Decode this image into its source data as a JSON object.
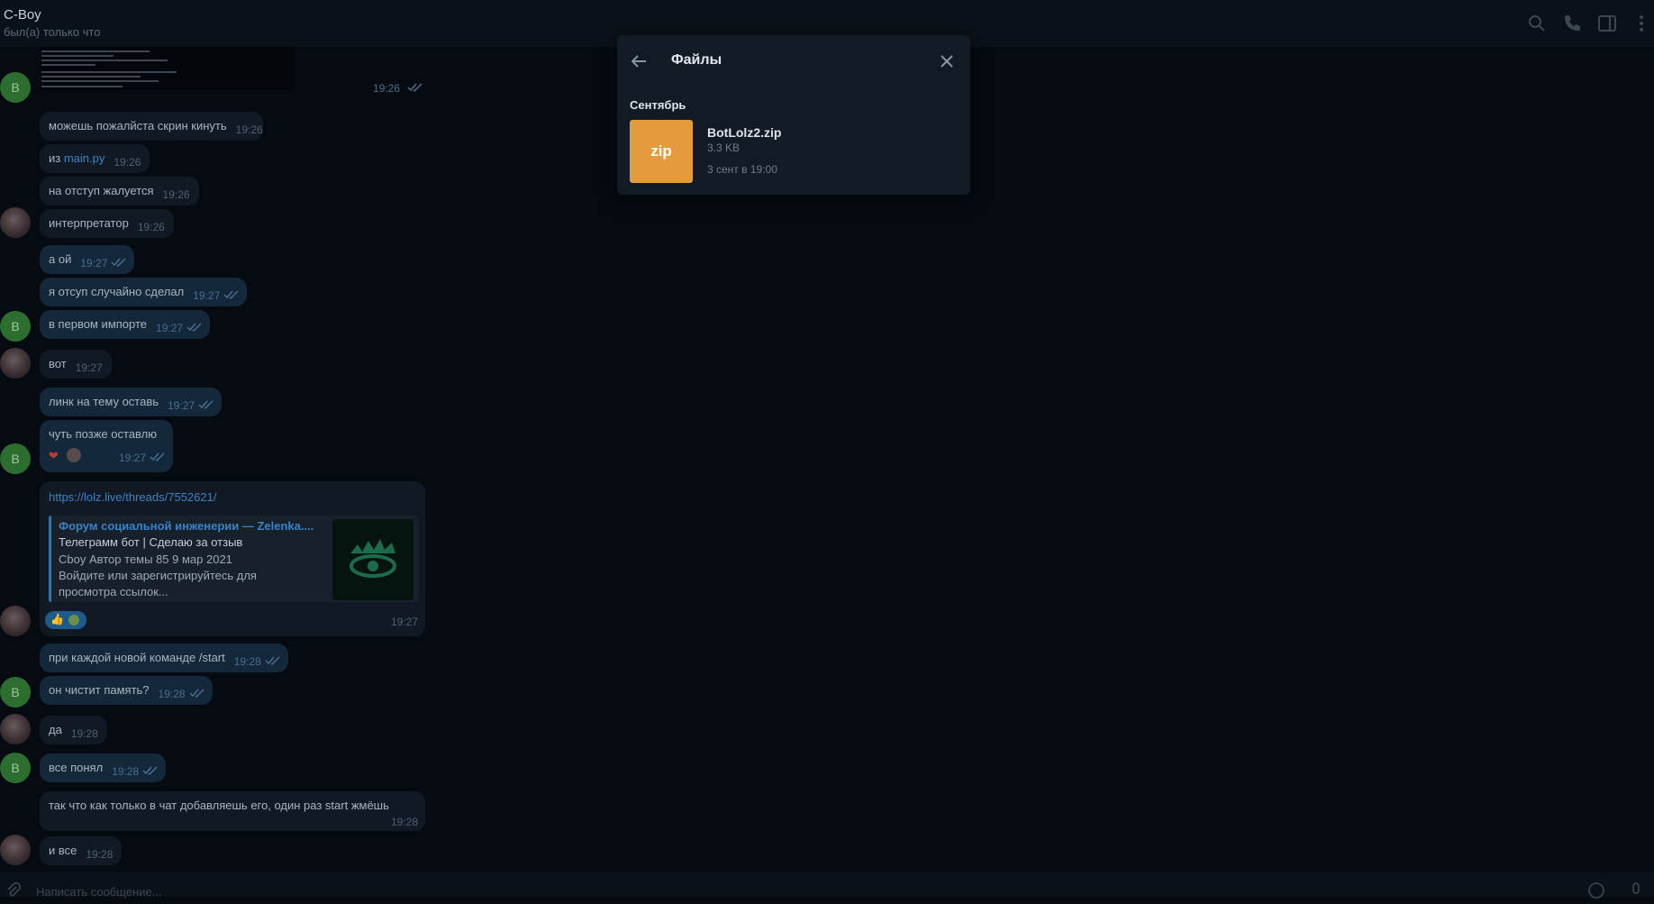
{
  "header": {
    "name": "C-Boy",
    "status": "был(а) только что"
  },
  "messages": [
    {
      "time": "19:26"
    },
    {
      "text": "можешь пожалйста скрин кинуть",
      "time": "19:26"
    },
    {
      "prefix": "из ",
      "link": "main.py",
      "time": "19:26"
    },
    {
      "text": "на отступ жалуется",
      "time": "19:26"
    },
    {
      "text": "интерпретатор",
      "time": "19:26"
    },
    {
      "text": "а ой",
      "time": "19:27"
    },
    {
      "text": "я отсуп случайно сделал",
      "time": "19:27"
    },
    {
      "text": "в первом импорте",
      "time": "19:27"
    },
    {
      "text": "вот",
      "time": "19:27"
    },
    {
      "text": "линк на тему оставь",
      "time": "19:27"
    },
    {
      "text": "чуть позже оставлю",
      "time": "19:27"
    },
    {
      "link": "https://lolz.live/threads/7552621/",
      "time": "19:27"
    },
    {
      "text": "при каждой новой команде /start",
      "time": "19:28"
    },
    {
      "text": "он чистит память?",
      "time": "19:28"
    },
    {
      "text": "да",
      "time": "19:28"
    },
    {
      "text": "все понял",
      "time": "19:28"
    },
    {
      "text": "так что как только в чат добавляешь его, один раз start жмёшь",
      "time": "19:28"
    },
    {
      "text": "и все",
      "time": "19:28"
    }
  ],
  "avatar_letter": "B",
  "link_preview": {
    "site": "Форум социальной инженерии — Zelenka....",
    "title": "Телеграмм бот | Сделаю за отзыв",
    "line3": "Cboy   Автор темы 85 9 мар 2021",
    "desc": "Войдите или зарегистрируйтесь для просмотра ссылок..."
  },
  "files_panel": {
    "title": "Файлы",
    "section": "Сентябрь",
    "file": {
      "badge": "zip",
      "name": "BotLolz2.zip",
      "size": "3.3 KB",
      "date": "3 сент в 19:00"
    }
  },
  "input": {
    "placeholder": "Написать сообщение..."
  },
  "colors": {
    "background": "#060b11",
    "outgoing_bubble": "#14283c",
    "incoming_bubble": "#111a24",
    "link": "#3a82c4",
    "zip_badge": "#e49a3d",
    "avatar_green": "#2c6e2f"
  },
  "icons": [
    "search-icon",
    "phone-icon",
    "sidebar-toggle-icon",
    "more-icon",
    "back-arrow-icon",
    "close-icon",
    "attach-icon",
    "emoji-icon",
    "mic-icon",
    "double-check-icon"
  ]
}
